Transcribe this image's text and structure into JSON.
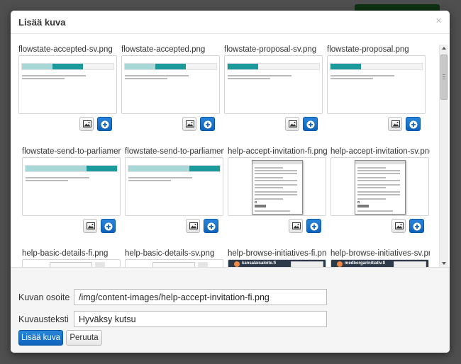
{
  "modal": {
    "title": "Lisää kuva",
    "close_symbol": "×"
  },
  "gallery": {
    "items": [
      {
        "filename": "flowstate-accepted-sv.png",
        "thumb": "flowstate"
      },
      {
        "filename": "flowstate-accepted.png",
        "thumb": "flowstate"
      },
      {
        "filename": "flowstate-proposal-sv.png",
        "thumb": "flowstate"
      },
      {
        "filename": "flowstate-proposal.png",
        "thumb": "flowstate"
      },
      {
        "filename": "flowstate-send-to-parliament-sv.png",
        "thumb": "flowstate"
      },
      {
        "filename": "flowstate-send-to-parliament.png",
        "thumb": "flowstate"
      },
      {
        "filename": "help-accept-invitation-fi.png",
        "thumb": "invitation"
      },
      {
        "filename": "help-accept-invitation-sv.png",
        "thumb": "invitation"
      },
      {
        "filename": "help-basic-details-fi.png",
        "thumb": "basic"
      },
      {
        "filename": "help-basic-details-sv.png",
        "thumb": "basic"
      },
      {
        "filename": "help-browse-initiatives-fi.png",
        "thumb": "browse"
      },
      {
        "filename": "help-browse-initiatives-sv.png",
        "thumb": "browse"
      }
    ],
    "accent_color": "#0e63bd",
    "flow_active_color": "#1a9a9a"
  },
  "thumb_text": {
    "brand_fi": "kansalaisaloite.fi",
    "brand_sv": "medborgarinitiativ.fi"
  },
  "form": {
    "url_label": "Kuvan osoite",
    "url_value": "/img/content-images/help-accept-invitation-fi.png",
    "caption_label": "Kuvausteksti",
    "caption_value": "Hyväksy kutsu",
    "submit_label": "Lisää kuva",
    "cancel_label": "Peruuta"
  }
}
